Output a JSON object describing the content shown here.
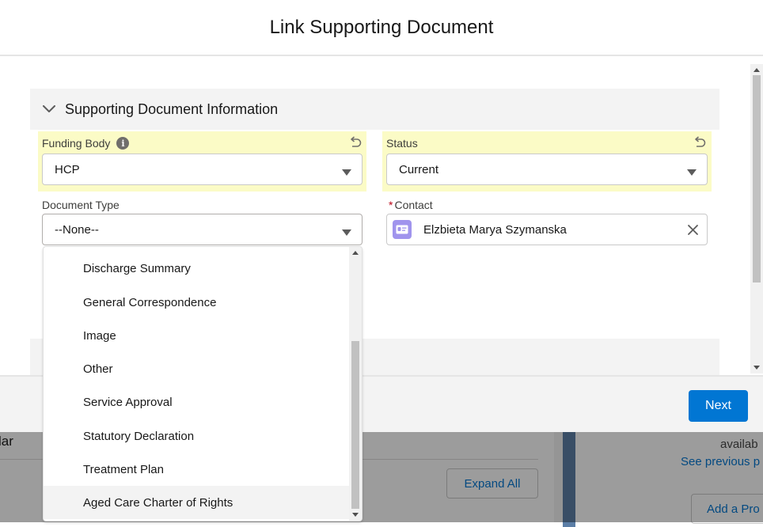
{
  "modal": {
    "title": "Link Supporting Document",
    "section_title": "Supporting Document Information",
    "next_label": "Next"
  },
  "fields": {
    "funding_body": {
      "label": "Funding Body",
      "value": "HCP"
    },
    "status": {
      "label": "Status",
      "value": "Current"
    },
    "document_type": {
      "label": "Document Type",
      "value": "--None--"
    },
    "contact": {
      "label": "Contact",
      "required_marker": "*",
      "value": "Elzbieta Marya Szymanska"
    }
  },
  "dropdown": {
    "options": [
      "Discharge Summary",
      "General Correspondence",
      "Image",
      "Other",
      "Service Approval",
      "Statutory Declaration",
      "Treatment Plan",
      "Aged Care Charter of Rights"
    ],
    "hovered_option": "Aged Care Charter of Rights"
  },
  "background": {
    "left_title": "lar",
    "expand_all_label": "Expand All",
    "available_text": "availab",
    "see_previous_text": "See previous p",
    "add_button_label": "Add a Pro"
  },
  "colors": {
    "brand": "#0176d3",
    "highlight_field": "#fbfbc6",
    "contact_avatar": "#a094ed",
    "required": "#ba0517"
  },
  "icons": {
    "section_toggle": "chevron-down-icon",
    "info": "info-icon",
    "undo": "undo-icon",
    "caret": "caret-down-icon",
    "contact": "contact-card-icon",
    "clear": "close-icon"
  }
}
